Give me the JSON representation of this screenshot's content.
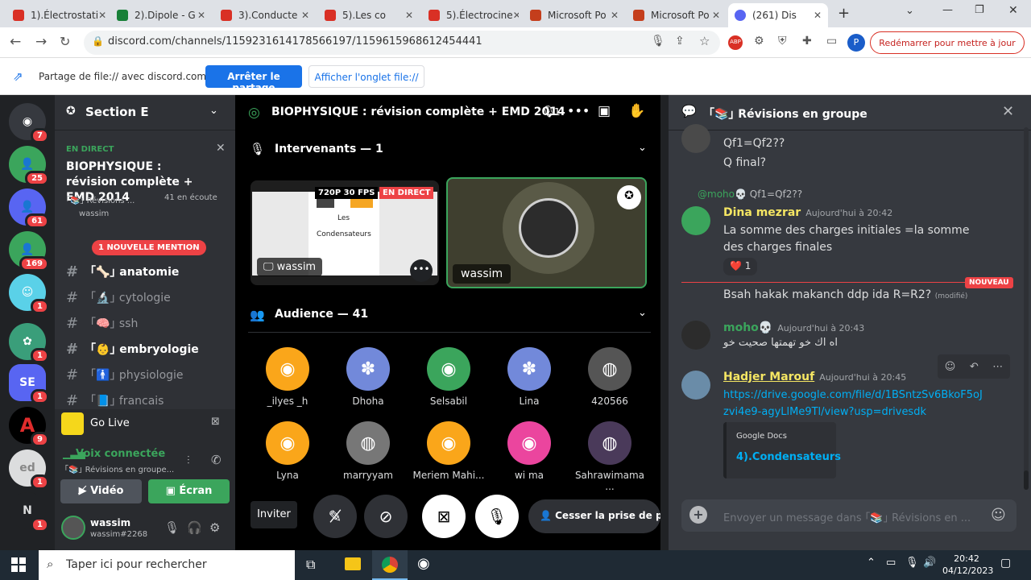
{
  "browser": {
    "tabs": [
      {
        "title": "1).Électrostati",
        "color": "#d93025"
      },
      {
        "title": "2).Dipole - G",
        "color": "#188038"
      },
      {
        "title": "3).Conducte",
        "color": "#d93025"
      },
      {
        "title": "5).Les co",
        "color": "#d93025"
      },
      {
        "title": "5).Électrocine",
        "color": "#d93025"
      },
      {
        "title": "Microsoft Po",
        "color": "#c43e1c"
      },
      {
        "title": "Microsoft Po",
        "color": "#c43e1c"
      },
      {
        "title": "(261) Dis",
        "color": "#5865f2",
        "active": true
      }
    ],
    "url": "discord.com/channels/1159231614178566197/1159615968612454441",
    "restart_label": "Redémarrer pour mettre à jour",
    "profile_initial": "P",
    "share_text": "Partage de file:// avec discord.com...",
    "stop_share_label": "Arrêter le partage",
    "show_tab_label": "Afficher l'onglet file://"
  },
  "servers": [
    {
      "label": "",
      "icon": "discord-home-icon",
      "badge": "7",
      "color": "#5865f2"
    },
    {
      "label": "",
      "icon": "user-icon",
      "badge": "25",
      "color": "#3ba55c"
    },
    {
      "label": "",
      "icon": "user-icon",
      "badge": "61",
      "color": "#5865f2"
    },
    {
      "label": "",
      "icon": "user-icon",
      "badge": "169",
      "color": "#3ba55c"
    },
    {
      "label": "",
      "icon": "face-icon",
      "badge": "1",
      "color": "#5ad1e8"
    },
    {
      "label": "",
      "icon": "creature-icon",
      "badge": "1",
      "color": "#3a9e7a"
    },
    {
      "label": "SE",
      "icon": "",
      "badge": "1",
      "color": "#5865f2"
    },
    {
      "label": "A",
      "icon": "",
      "badge": "9",
      "color": "#000000"
    },
    {
      "label": "ed",
      "icon": "",
      "badge": "1",
      "color": "#dcddde"
    },
    {
      "label": "N",
      "icon": "",
      "badge": "1",
      "color": "#202225"
    }
  ],
  "sidebar": {
    "server_name": "Section E",
    "live_label": "EN DIRECT",
    "stage_title": "BIOPHYSIQUE : révision complète + EMD 2014",
    "stage_channel": "｢📚｣ Révisions ...",
    "stage_listeners": "41 en écoute",
    "stage_host": "wassim",
    "mention_label": "1 NOUVELLE MENTION",
    "channels": [
      {
        "name": "｢🦴｣ anatomie",
        "unread": true
      },
      {
        "name": "｢🔬｣ cytologie",
        "unread": false
      },
      {
        "name": "｢🧠｣ ssh",
        "unread": false
      },
      {
        "name": "｢👶｣ embryologie",
        "unread": true
      },
      {
        "name": "｢🚹｣ physiologie",
        "unread": false
      },
      {
        "name": "｢📘｣ francais",
        "unread": false
      }
    ],
    "go_live": "Go Live",
    "voice_connected": "Voix connectée",
    "voice_channel": "｢📚｣ Révisions en groupe...",
    "video_label": "Vidéo",
    "screen_label": "Écran",
    "user_name": "wassim",
    "user_tag": "wassim#2268"
  },
  "stage": {
    "title": "BIOPHYSIQUE : révision complète + EMD 2014",
    "speakers_count": "1",
    "speakers_header": "Intervenants — 1",
    "stream_quality": "720P 30 FPS",
    "live_badge": "EN DIRECT",
    "stream_user": "wassim",
    "slide_title": "Les",
    "slide_subtitle": "Condensateurs",
    "camera_user": "wassim",
    "audience_header": "Audience — 41",
    "audience": [
      {
        "name": "_ilyes _h",
        "color": "#faa61a",
        "icon": "discord-icon"
      },
      {
        "name": "Dhoha",
        "color": "#7289da",
        "icon": "bunny-icon"
      },
      {
        "name": "Selsabil",
        "color": "#3ba55c",
        "icon": "discord-icon"
      },
      {
        "name": "Lina",
        "color": "#7289da",
        "icon": "bunny-icon"
      },
      {
        "name": "420566",
        "color": "#555555",
        "icon": "photo-icon"
      },
      {
        "name": "Lyna",
        "color": "#faa61a",
        "icon": "discord-icon"
      },
      {
        "name": "marryyam",
        "color": "#777777",
        "icon": "photo-icon"
      },
      {
        "name": "Meriem Mahi...",
        "color": "#faa61a",
        "icon": "discord-icon"
      },
      {
        "name": "wi ma",
        "color": "#eb459e",
        "icon": "discord-icon"
      },
      {
        "name": "Sahrawimama ...",
        "color": "#4a3a5a",
        "icon": "photo-icon"
      }
    ],
    "invite_label": "Inviter",
    "stop_speaking_label": "Cesser la prise de par"
  },
  "chat": {
    "title": "｢📚｣ Révisions en groupe",
    "messages": [
      {
        "lines": [
          "Qf1=Qf2??",
          "Q final?"
        ]
      },
      {
        "reply_to": "@moho💀",
        "reply_text": "Qf1=Qf2??",
        "author": "Dina mezrar",
        "author_color": "#f5e663",
        "time": "Aujourd'hui à 20:42",
        "text": "La somme des charges initiales =la somme des charges finales",
        "reaction": "❤️",
        "reaction_count": "1"
      },
      {
        "text": "Bsah hakak makanch ddp ida R=R2?",
        "edited": "(modifié)",
        "new_label": "NOUVEAU"
      },
      {
        "author": "moho💀",
        "author_color": "#3ba55c",
        "time": "Aujourd'hui à 20:43",
        "text": "اه اك خو تهمتها صحيت خو"
      },
      {
        "author": "Hadjer Marouf",
        "author_color": "#f5e663",
        "time": "Aujourd'hui à 20:45",
        "link": "https://drive.google.com/file/d/1BSntzSv6BkoF5oJzvi4e9-agyLlMe9Tl/view?usp=drivesdk",
        "embed_provider": "Google Docs",
        "embed_title": "4).Condensateurs"
      }
    ],
    "input_placeholder": "Envoyer un message dans ｢📚｣ Révisions en ..."
  },
  "taskbar": {
    "search_placeholder": "Taper ici pour rechercher",
    "time": "20:42",
    "date": "04/12/2023"
  }
}
